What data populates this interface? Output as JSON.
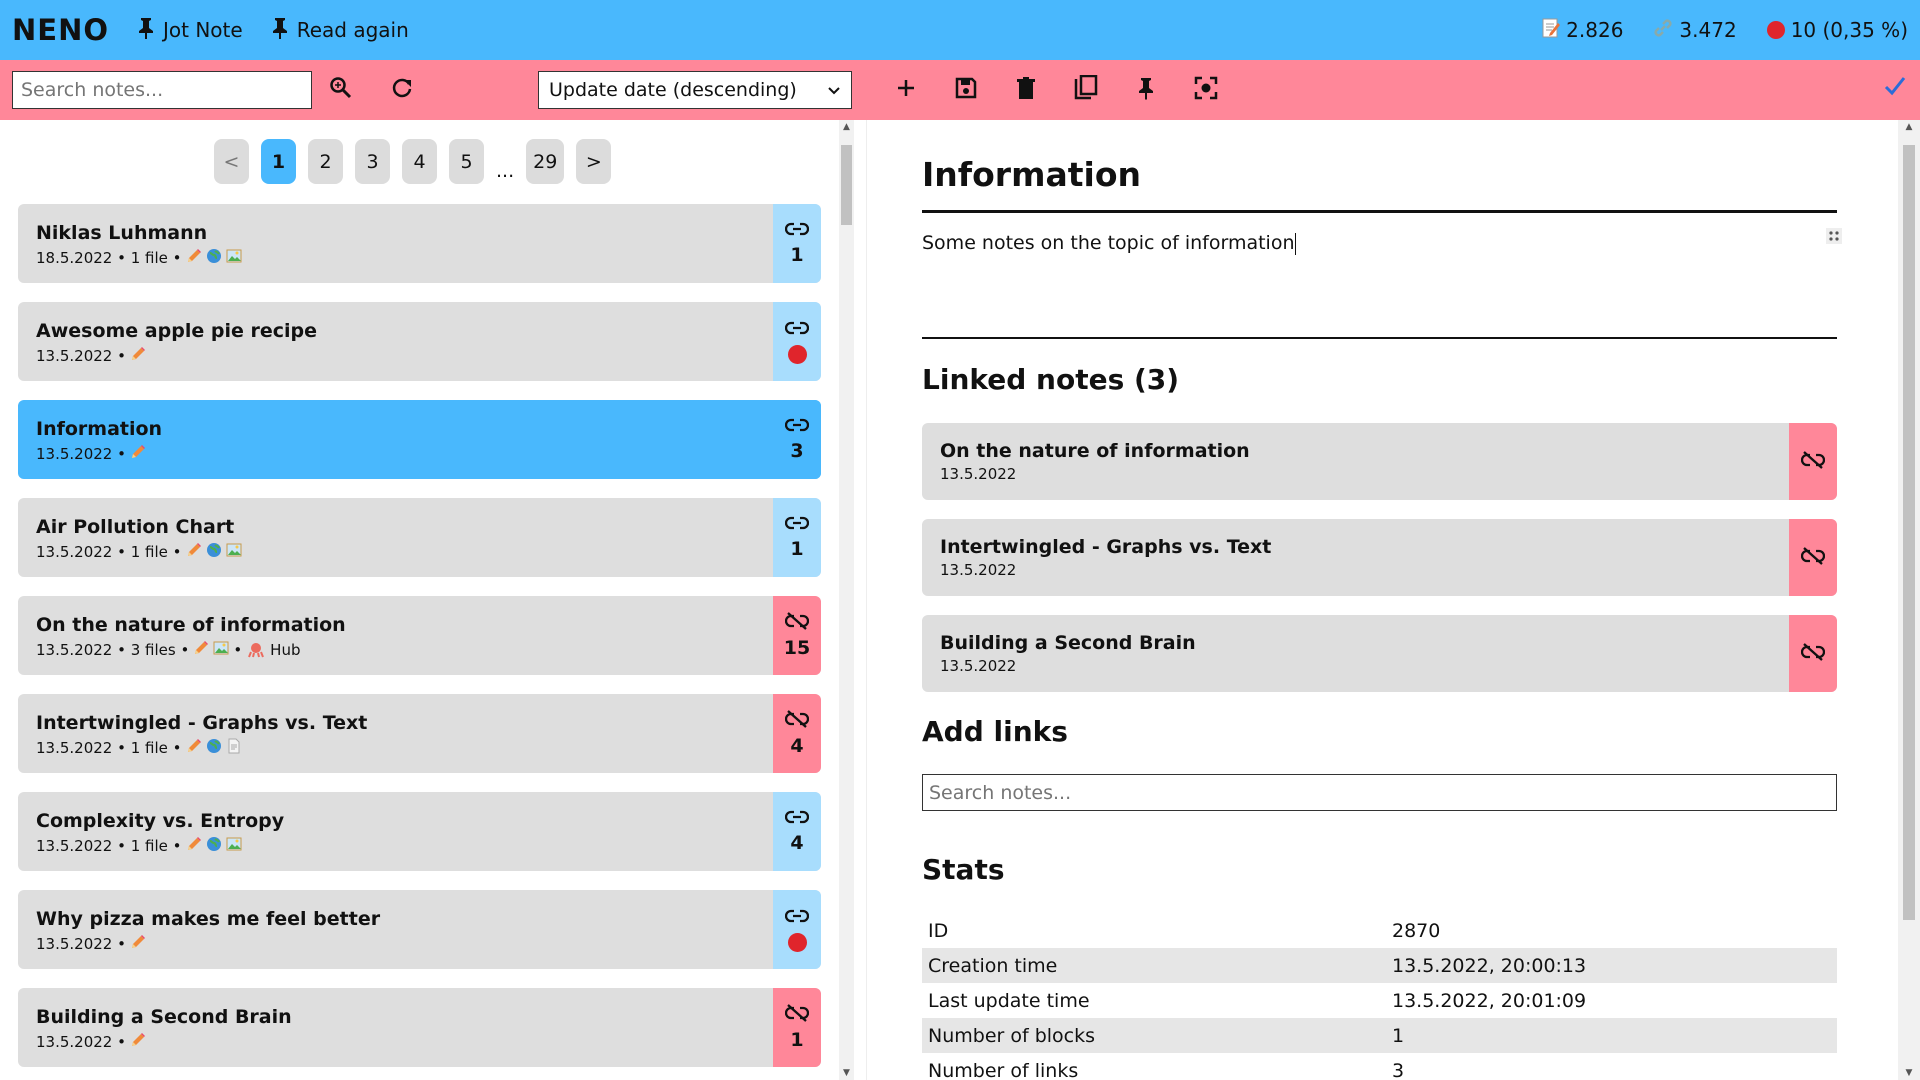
{
  "app": {
    "brand": "NENO",
    "buttons": [
      {
        "label": "Jot Note"
      },
      {
        "label": "Read again"
      }
    ],
    "stats": {
      "notes": "2.826",
      "links": "3.472",
      "unlinked": "10 (0,35 %)"
    }
  },
  "toolbar": {
    "search_placeholder": "Search notes...",
    "sort_value": "Update date (descending)"
  },
  "pager": {
    "prev": "<",
    "pages": [
      "1",
      "2",
      "3",
      "4",
      "5"
    ],
    "ellipsis": "...",
    "last": "29",
    "next": ">",
    "active": "1"
  },
  "notes": [
    {
      "title": "Niklas Luhmann",
      "meta": "18.5.2022 • 1 file •",
      "icons": [
        "pencil",
        "globe",
        "image"
      ],
      "linked": true,
      "count": "1"
    },
    {
      "title": "Awesome apple pie recipe",
      "meta": "13.5.2022 •",
      "icons": [
        "pencil"
      ],
      "linked": true,
      "count": ""
    },
    {
      "title": "Information",
      "meta": "13.5.2022 •",
      "icons": [
        "pencil"
      ],
      "linked": true,
      "count": "3",
      "selected": true
    },
    {
      "title": "Air Pollution Chart",
      "meta": "13.5.2022 • 1 file •",
      "icons": [
        "pencil",
        "globe",
        "image"
      ],
      "linked": true,
      "count": "1"
    },
    {
      "title": "On the nature of information",
      "meta": "13.5.2022 • 3 files •",
      "icons": [
        "pencil",
        "image"
      ],
      "extra": "Hub",
      "linked": false,
      "count": "15"
    },
    {
      "title": "Intertwingled - Graphs vs. Text",
      "meta": "13.5.2022 • 1 file •",
      "icons": [
        "pencil",
        "globe",
        "document"
      ],
      "linked": false,
      "count": "4"
    },
    {
      "title": "Complexity vs. Entropy",
      "meta": "13.5.2022 • 1 file •",
      "icons": [
        "pencil",
        "globe",
        "image"
      ],
      "linked": true,
      "count": "4"
    },
    {
      "title": "Why pizza makes me feel better",
      "meta": "13.5.2022 •",
      "icons": [
        "pencil"
      ],
      "linked": true,
      "count": ""
    },
    {
      "title": "Building a Second Brain",
      "meta": "13.5.2022 •",
      "icons": [
        "pencil"
      ],
      "linked": false,
      "count": "1"
    }
  ],
  "editor": {
    "title": "Information",
    "body": "Some notes on the topic of information",
    "linked_heading": "Linked notes (3)",
    "linked_notes": [
      {
        "title": "On the nature of information",
        "date": "13.5.2022"
      },
      {
        "title": "Intertwingled - Graphs vs. Text",
        "date": "13.5.2022"
      },
      {
        "title": "Building a Second Brain",
        "date": "13.5.2022"
      }
    ],
    "add_links_heading": "Add links",
    "add_links_placeholder": "Search notes...",
    "stats_heading": "Stats",
    "stats": [
      {
        "label": "ID",
        "value": "2870"
      },
      {
        "label": "Creation time",
        "value": "13.5.2022, 20:00:13"
      },
      {
        "label": "Last update time",
        "value": "13.5.2022, 20:01:09"
      },
      {
        "label": "Number of blocks",
        "value": "1"
      },
      {
        "label": "Number of links",
        "value": "3"
      }
    ]
  },
  "colors": {
    "header": "#49b8fd",
    "toolbar": "#ff8799",
    "linked_light": "#a8ddfd",
    "unlinked": "#ff8799",
    "unlinked_dot": "#e0252c"
  }
}
